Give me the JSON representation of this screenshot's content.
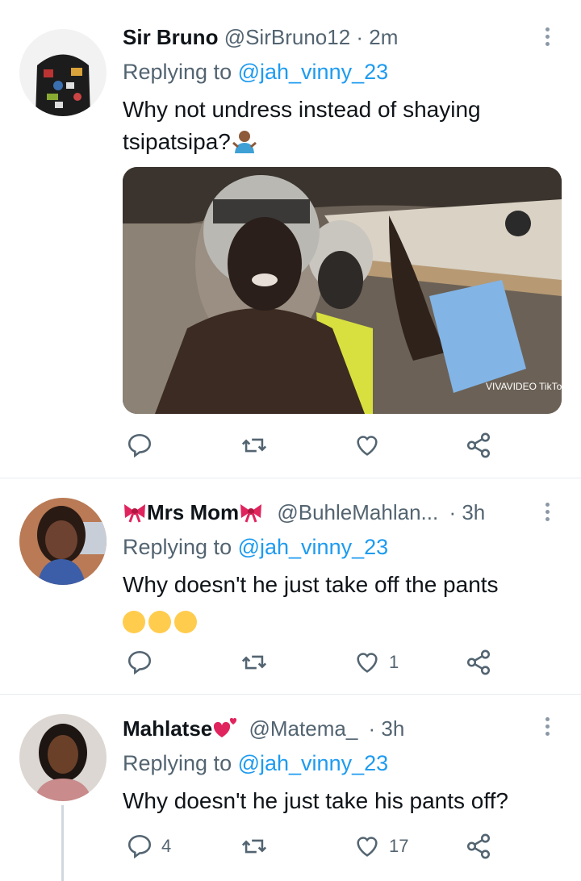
{
  "tweets": [
    {
      "display_name": "Sir Bruno",
      "handle": "@SirBruno12",
      "time": "· 2m",
      "replying_prefix": "Replying to ",
      "replying_to": "@jah_vinny_23",
      "text_line1": "Why not undress instead of shaying",
      "text_line2": "tsipatsipa?",
      "media_watermark": "VIVAVIDEO TikTok",
      "actions": {
        "reply_count": "",
        "retweet_count": "",
        "like_count": ""
      }
    },
    {
      "display_name": "Mrs Mom",
      "handle": "@BuhleMahlan...",
      "time": "· 3h",
      "replying_prefix": "Replying to ",
      "replying_to": "@jah_vinny_23",
      "text_line1": "Why doesn't he just take off the pants",
      "actions": {
        "reply_count": "",
        "retweet_count": "",
        "like_count": "1"
      }
    },
    {
      "display_name": "Mahlatse",
      "handle": "@Matema_",
      "time": "· 3h",
      "replying_prefix": "Replying to ",
      "replying_to": "@jah_vinny_23",
      "text_line1": "Why doesn't he just take his pants off?",
      "actions": {
        "reply_count": "4",
        "retweet_count": "",
        "like_count": "17"
      }
    }
  ],
  "colors": {
    "link": "#1d9bf0",
    "muted": "#536471",
    "text": "#0f1419",
    "divider": "#e6ecf0"
  },
  "icons": [
    "reply-icon",
    "retweet-icon",
    "like-icon",
    "share-icon",
    "more-icon",
    "bow-emoji",
    "heart-emoji",
    "shrug-emoji",
    "crying-emoji",
    "laughing-emoji"
  ]
}
